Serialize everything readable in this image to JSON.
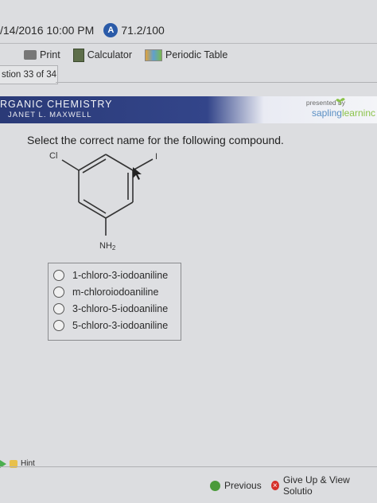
{
  "header": {
    "datetime": "/14/2016 10:00 PM",
    "score_icon": "A",
    "score": "71.2/100"
  },
  "toolbar": {
    "print_label": "Print",
    "calculator_label": "Calculator",
    "periodic_table_label": "Periodic Table"
  },
  "question_tab": {
    "label": "stion 33 of 34"
  },
  "banner": {
    "course_title": "RGANIC CHEMISTRY",
    "author": "JANET L. MAXWELL",
    "presented_by": "presented by",
    "brand_sapling": "sapling",
    "brand_learning": "learninc"
  },
  "question": {
    "prompt": "Select the correct name for the following compound.",
    "molecule_labels": {
      "cl": "Cl",
      "i": "I",
      "nh2": "NH",
      "nh2_sub": "2"
    },
    "options": [
      "1-chloro-3-iodoaniline",
      "m-chloroiodoaniline",
      "3-chloro-5-iodoaniline",
      "5-chloro-3-iodoaniline"
    ]
  },
  "footer": {
    "hint_label": "Hint",
    "previous_label": "Previous",
    "give_up_label": "Give Up & View Solutio"
  },
  "colors": {
    "banner_dark": "#2a3a77",
    "brand_blue": "#5a8fc4",
    "brand_green": "#8bc34a",
    "previous_green": "#4a9a3a",
    "give_up_red": "#d6302a"
  }
}
